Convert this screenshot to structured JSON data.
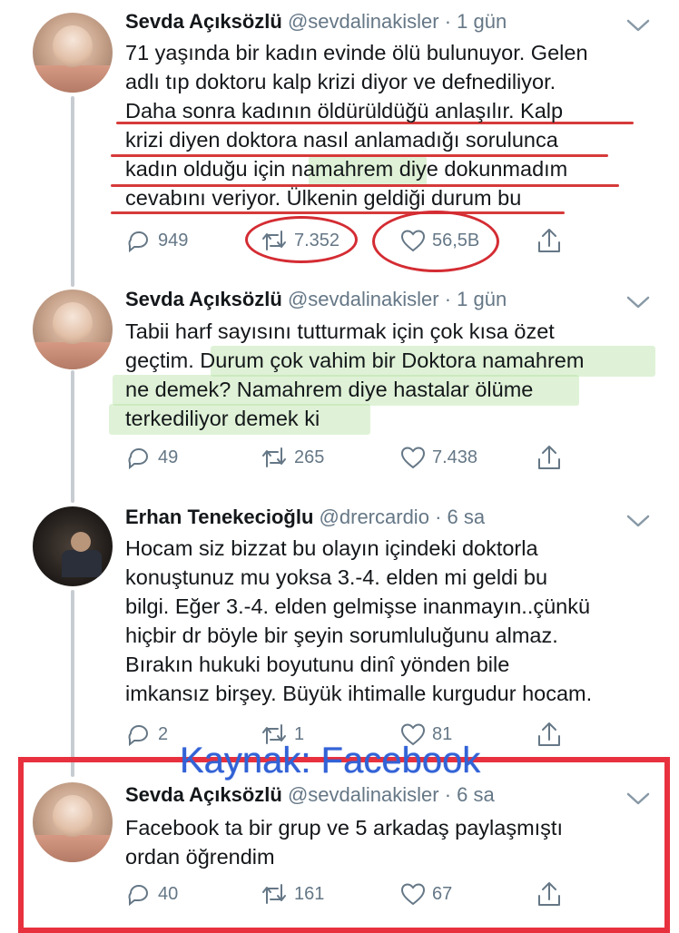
{
  "tweets": [
    {
      "name": "Sevda Açıksözlü",
      "handle": "@sevdalinakisler",
      "time": "· 1 gün",
      "lines": [
        "71 yaşında bir kadın evinde ölü bulunuyor. Gelen",
        "adlı tıp  doktoru kalp krizi diyor ve defnediliyor.",
        "Daha sonra kadının öldürüldüğü anlaşılır. Kalp",
        "krizi diyen doktora nasıl anlamadığı sorulunca",
        "kadın olduğu için namahrem diye dokunmadım",
        "cevabını veriyor. Ülkenin geldiği durum bu"
      ],
      "replies": "949",
      "retweets": "7.352",
      "likes": "56,5B"
    },
    {
      "name": "Sevda Açıksözlü",
      "handle": "@sevdalinakisler",
      "time": "· 1 gün",
      "lines": [
        "Tabii harf sayısını tutturmak için çok kısa özet",
        "geçtim. Durum çok vahim bir Doktora namahrem",
        "ne demek? Namahrem diye hastalar ölüme",
        "terkediliyor demek ki"
      ],
      "replies": "49",
      "retweets": "265",
      "likes": "7.438"
    },
    {
      "name": "Erhan Tenekecioğlu",
      "handle": "@drercardio",
      "time": "· 6 sa",
      "lines": [
        "Hocam siz bizzat bu olayın içindeki doktorla",
        "konuştunuz mu yoksa 3.-4.  elden mi geldi bu",
        "bilgi. Eğer 3.-4. elden gelmişse inanmayın..çünkü",
        "hiçbir dr böyle bir şeyin sorumluluğunu almaz.",
        "Bırakın hukuki boyutunu dinî yönden bile",
        "imkansız birşey. Büyük ihtimalle kurgudur hocam."
      ],
      "replies": "2",
      "retweets": "1",
      "likes": "81"
    },
    {
      "name": "Sevda Açıksözlü",
      "handle": "@sevdalinakisler",
      "time": "· 6 sa",
      "lines": [
        "Facebook ta bir grup ve 5 arkadaş paylaşmıştı",
        "ordan öğrendim"
      ],
      "replies": "40",
      "retweets": "161",
      "likes": "67"
    }
  ],
  "overlay": {
    "source_label": "Kaynak: Facebook",
    "annotation_color": "#d63a3a",
    "highlight_color": "#aadc96",
    "box_color": "#e8313f",
    "label_color": "#3262d6"
  }
}
